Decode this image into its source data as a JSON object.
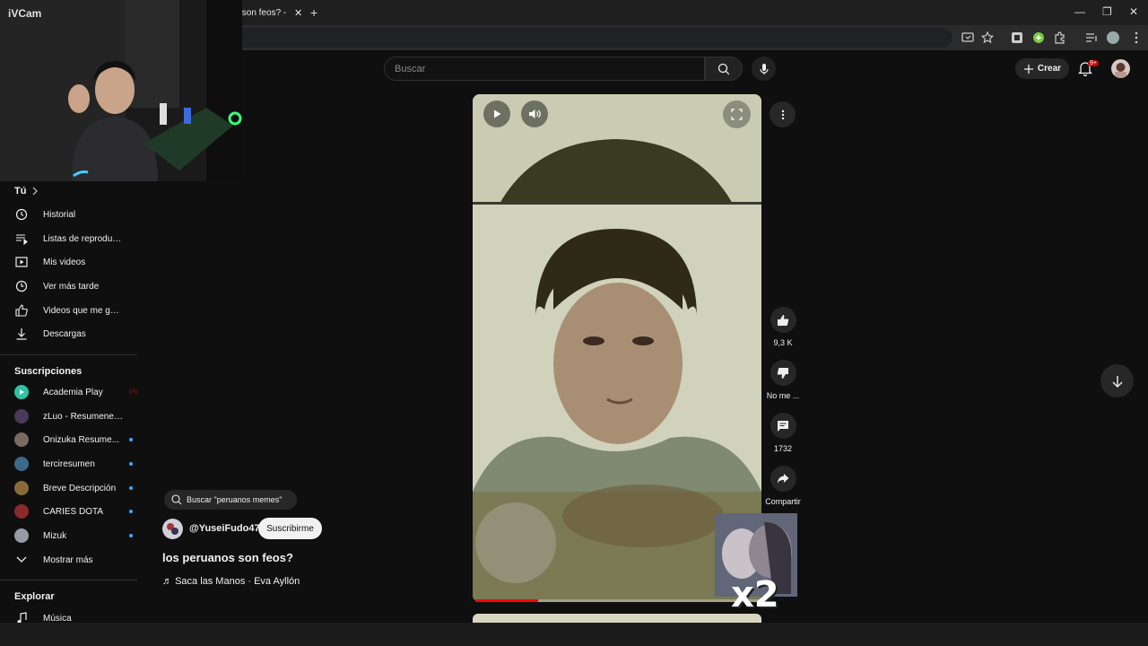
{
  "browser": {
    "tab_title": "s son feos? - ",
    "tab_close": "✕",
    "new_tab": "+",
    "window_controls": [
      "—",
      "❐",
      "✕"
    ]
  },
  "ivcam": {
    "title": "iVCam"
  },
  "header": {
    "search_placeholder": "Buscar",
    "create_label": "Crear",
    "notifications_badge": "9+"
  },
  "sidebar": {
    "you_title": "Tú",
    "you_items": [
      {
        "label": "Historial",
        "icon": "history-icon"
      },
      {
        "label": "Listas de reproducc...",
        "icon": "playlist-icon"
      },
      {
        "label": "Mis videos",
        "icon": "my-videos-icon"
      },
      {
        "label": "Ver más tarde",
        "icon": "watch-later-icon"
      },
      {
        "label": "Videos que me gus...",
        "icon": "liked-icon"
      },
      {
        "label": "Descargas",
        "icon": "download-icon"
      }
    ],
    "subs_title": "Suscripciones",
    "subscriptions": [
      {
        "name": "Academia Play",
        "status": "live",
        "color": "#2dc3a3"
      },
      {
        "name": "zLuo - Resumenes ...",
        "status": "none",
        "color": "#4a3a5a"
      },
      {
        "name": "Onizuka Resume...",
        "status": "new",
        "color": "#7a6a60"
      },
      {
        "name": "terciresumen",
        "status": "new",
        "color": "#3b6a8a"
      },
      {
        "name": "Breve Descripción",
        "status": "new",
        "color": "#8a6a3a"
      },
      {
        "name": "CARIES DOTA",
        "status": "new",
        "color": "#8a2a2a"
      },
      {
        "name": "Mizuk",
        "status": "new",
        "color": "#9a9aa5"
      }
    ],
    "live_label": "((•))",
    "show_more": "Mostrar más",
    "explore_title": "Explorar",
    "explore_items": [
      {
        "label": "Música",
        "icon": "music-icon"
      }
    ]
  },
  "short": {
    "related_search": "Buscar \"peruanos memes\"",
    "channel": "@YuseiFudo47",
    "subscribe_label": "Suscribirme",
    "title": "los peruanos son feos?",
    "music": "Saca las Manos · Eva Ayllón",
    "progress": 0.22,
    "overlay_text": "x2"
  },
  "actions": {
    "like_count": "9,3 K",
    "dislike_label": "No me ...",
    "comment_count": "1732",
    "share_label": "Compartir"
  }
}
